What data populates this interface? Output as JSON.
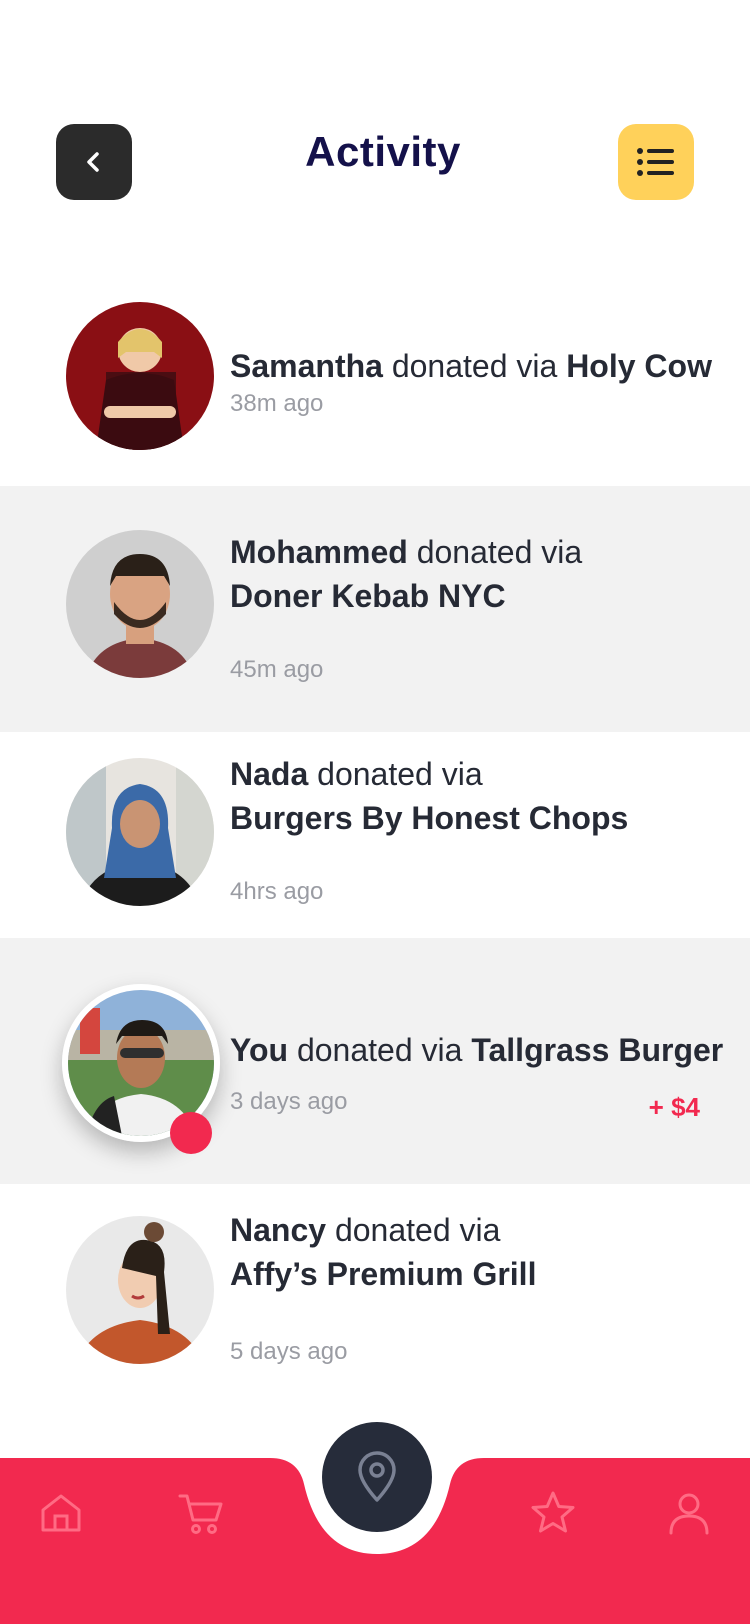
{
  "header": {
    "title": "Activity",
    "back_icon": "chevron-left-icon",
    "menu_icon": "list-icon"
  },
  "activities": [
    {
      "name": "Samantha",
      "verb": "donated via",
      "place": "Holy Cow",
      "time": "38m ago"
    },
    {
      "name": "Mohammed",
      "verb": "donated via",
      "place": "Doner Kebab NYC",
      "time": "45m ago"
    },
    {
      "name": "Nada",
      "verb": "donated via",
      "place": "Burgers By Honest Chops",
      "time": "4hrs ago"
    },
    {
      "name": "You",
      "verb": "donated via",
      "place": "Tallgrass Burger",
      "time": "3 days ago",
      "amount": "+ $4"
    },
    {
      "name": "Nancy",
      "verb": "donated via",
      "place": "Affy’s Premium Grill",
      "time": "5 days ago"
    }
  ],
  "tabbar": {
    "icons": [
      "home-icon",
      "cart-icon",
      "map-pin-icon",
      "star-icon",
      "user-icon"
    ]
  },
  "colors": {
    "accent": "#f2294f",
    "dark": "#262c3a",
    "yellow": "#ffd15a",
    "title": "#14114a"
  }
}
